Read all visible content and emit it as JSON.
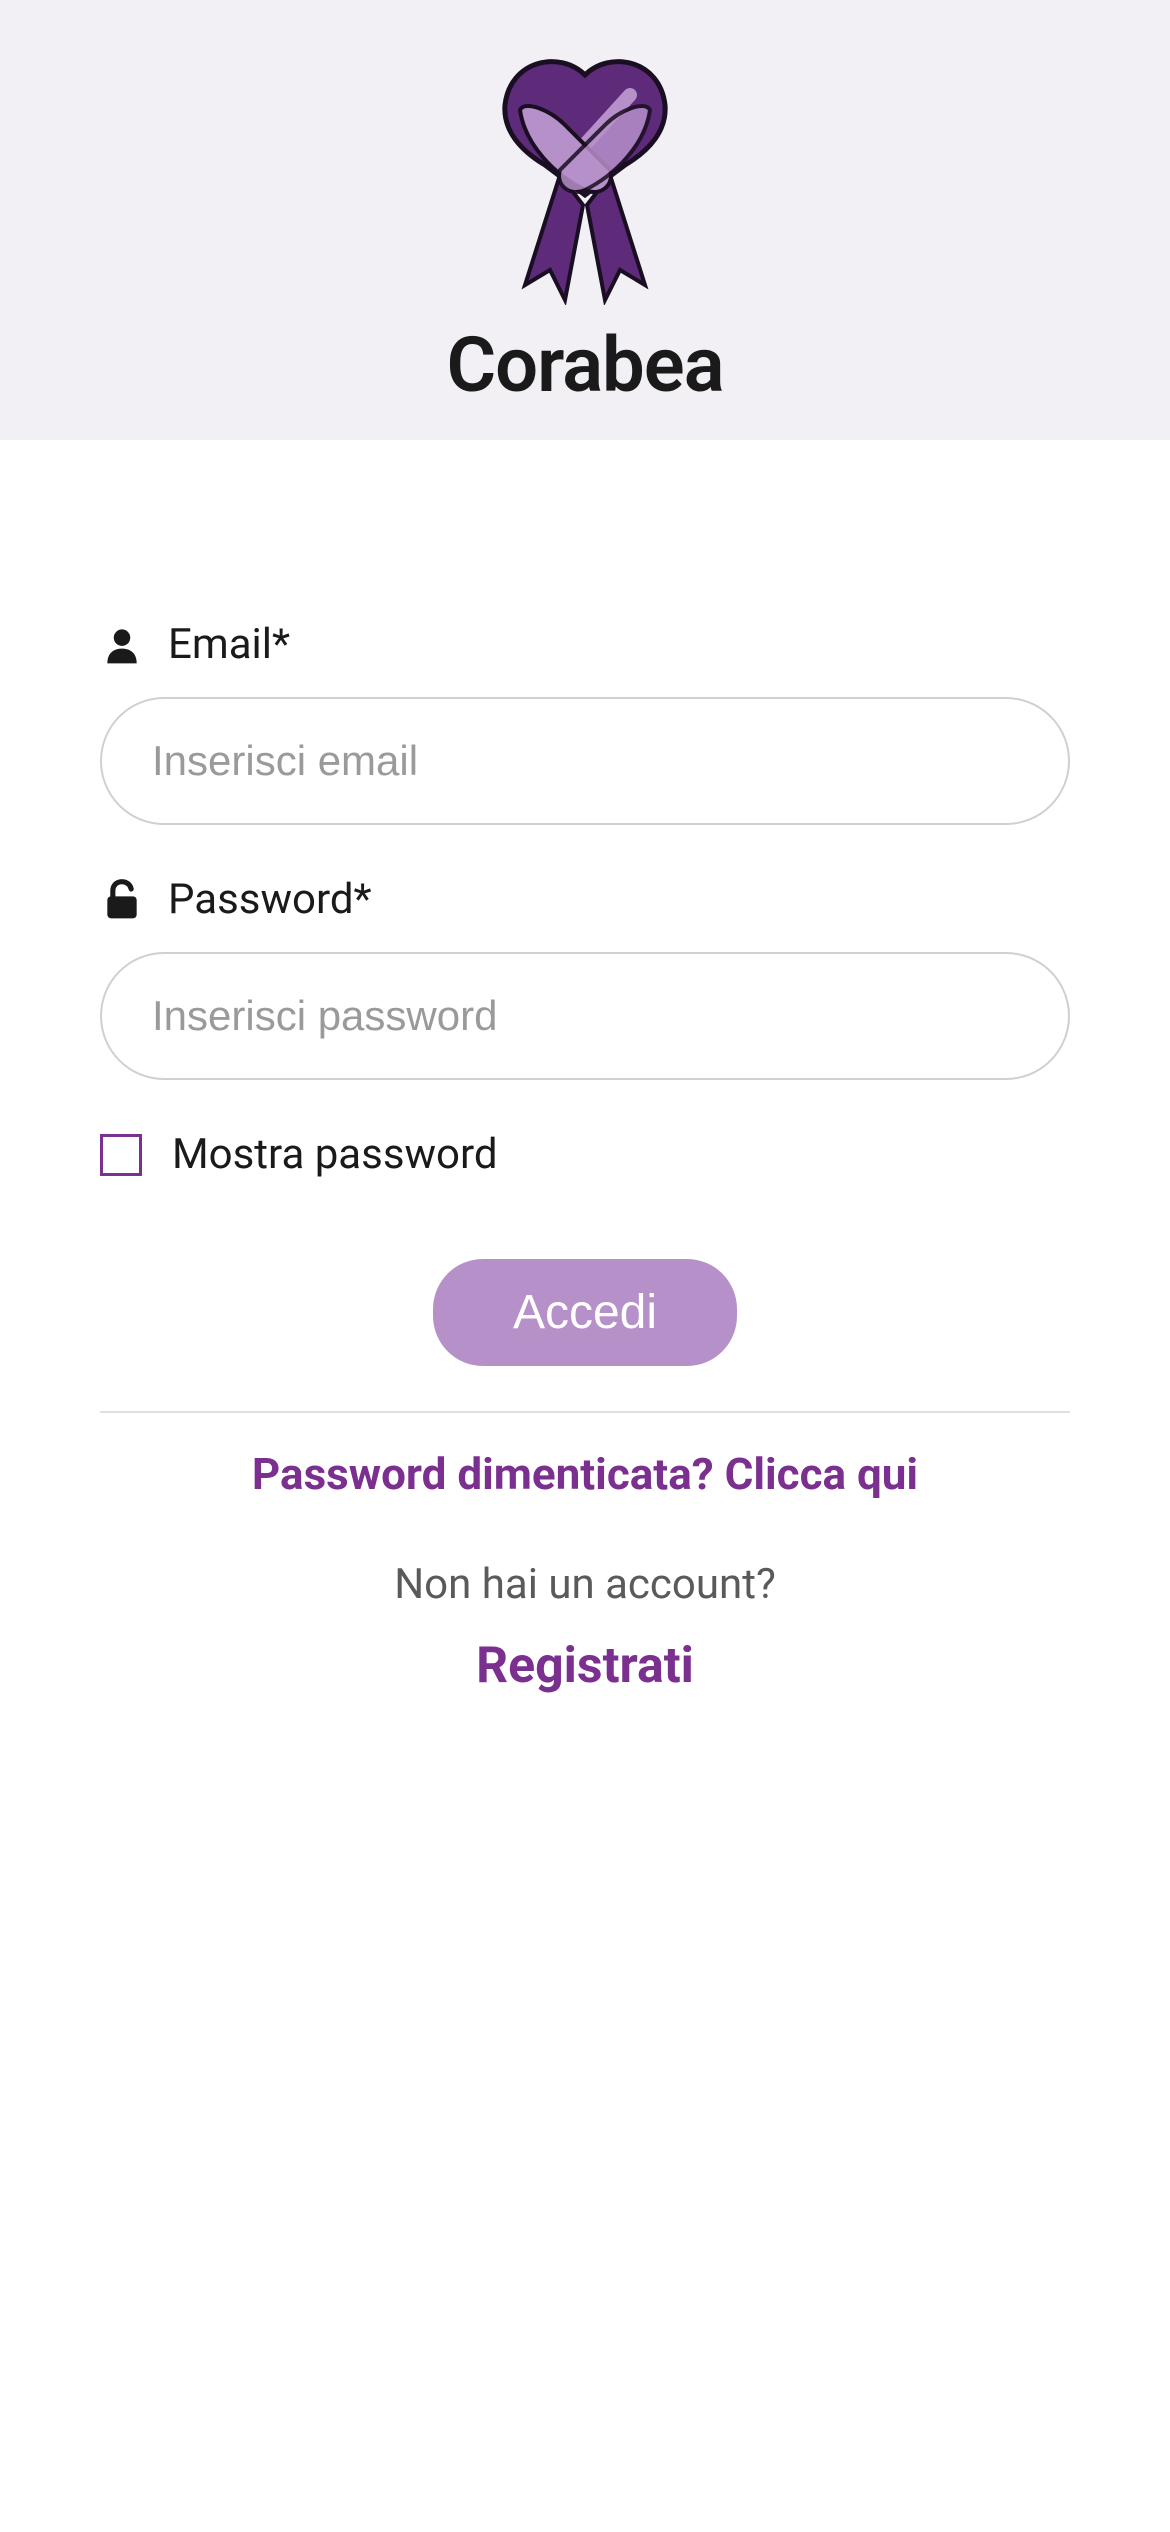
{
  "header": {
    "app_name": "Corabea"
  },
  "form": {
    "email": {
      "label": "Email*",
      "placeholder": "Inserisci email",
      "value": ""
    },
    "password": {
      "label": "Password*",
      "placeholder": "Inserisci password",
      "value": ""
    },
    "show_password": {
      "label": "Mostra password"
    },
    "submit_label": "Accedi"
  },
  "links": {
    "forgot_password": "Password dimenticata? Clicca qui",
    "no_account_text": "Non hai un account?",
    "register": "Registrati"
  },
  "colors": {
    "brand_purple": "#7b2f8f",
    "brand_purple_light": "#b690c9",
    "header_bg": "#f2eff5"
  }
}
